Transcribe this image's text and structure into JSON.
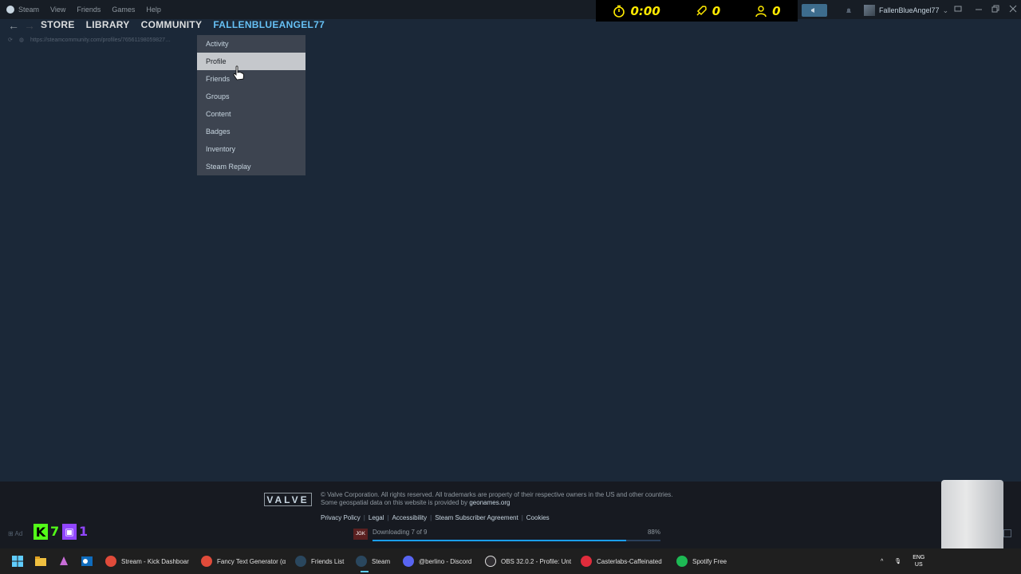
{
  "menubar": {
    "steam": "Steam",
    "items": [
      "View",
      "Friends",
      "Games",
      "Help"
    ]
  },
  "overlay": {
    "timer": "0:00",
    "rocket_count": "0",
    "user_count": "0",
    "accent": "#ffea00"
  },
  "account": {
    "name": "FallenBlueAngel77"
  },
  "nav": {
    "store": "STORE",
    "library": "LIBRARY",
    "community": "COMMUNITY",
    "profile": "FALLENBLUEANGEL77",
    "url": "https://steamcommunity.com/profiles/76561198059827…"
  },
  "dropdown": {
    "items": [
      "Activity",
      "Profile",
      "Friends",
      "Groups",
      "Content",
      "Badges",
      "Inventory",
      "Steam Replay"
    ],
    "hovered": "Profile"
  },
  "footer": {
    "valve": "VALVE",
    "copyright_1": "© Valve Corporation. All rights reserved. All trademarks are property of their respective owners in the US and other countries.",
    "copyright_2_prefix": "Some geospatial data on this website is provided by ",
    "copyright_2_link": "geonames.org",
    "links": [
      "Privacy Policy",
      "Legal",
      "Accessibility",
      "Steam Subscriber Agreement",
      "Cookies"
    ]
  },
  "stream_badges": {
    "kick_count": "7",
    "twitch_count": "1",
    "kick_color": "#53fc18",
    "twitch_color": "#9146ff"
  },
  "bottom_left_label": "Ad",
  "download": {
    "icon": "JGK",
    "status": "Downloading 7 of 9",
    "percent": "88%",
    "progress": 0.88
  },
  "taskbar": {
    "apps": [
      {
        "label": "Stream - Kick Dashboar",
        "icon": "chrome-icon"
      },
      {
        "label": "Fancy Text Generator (α",
        "icon": "chrome-icon"
      },
      {
        "label": "Friends List",
        "icon": "steam-icon"
      },
      {
        "label": "Steam",
        "icon": "steam-icon"
      },
      {
        "label": "@berlino - Discord",
        "icon": "discord-icon"
      },
      {
        "label": "OBS 32.0.2 - Profile: Unt",
        "icon": "obs-icon"
      },
      {
        "label": "Casterlabs-Caffeinated",
        "icon": "casterlabs-icon"
      },
      {
        "label": "Spotify Free",
        "icon": "spotify-icon"
      }
    ],
    "lang_1": "ENG",
    "lang_2": "US"
  }
}
